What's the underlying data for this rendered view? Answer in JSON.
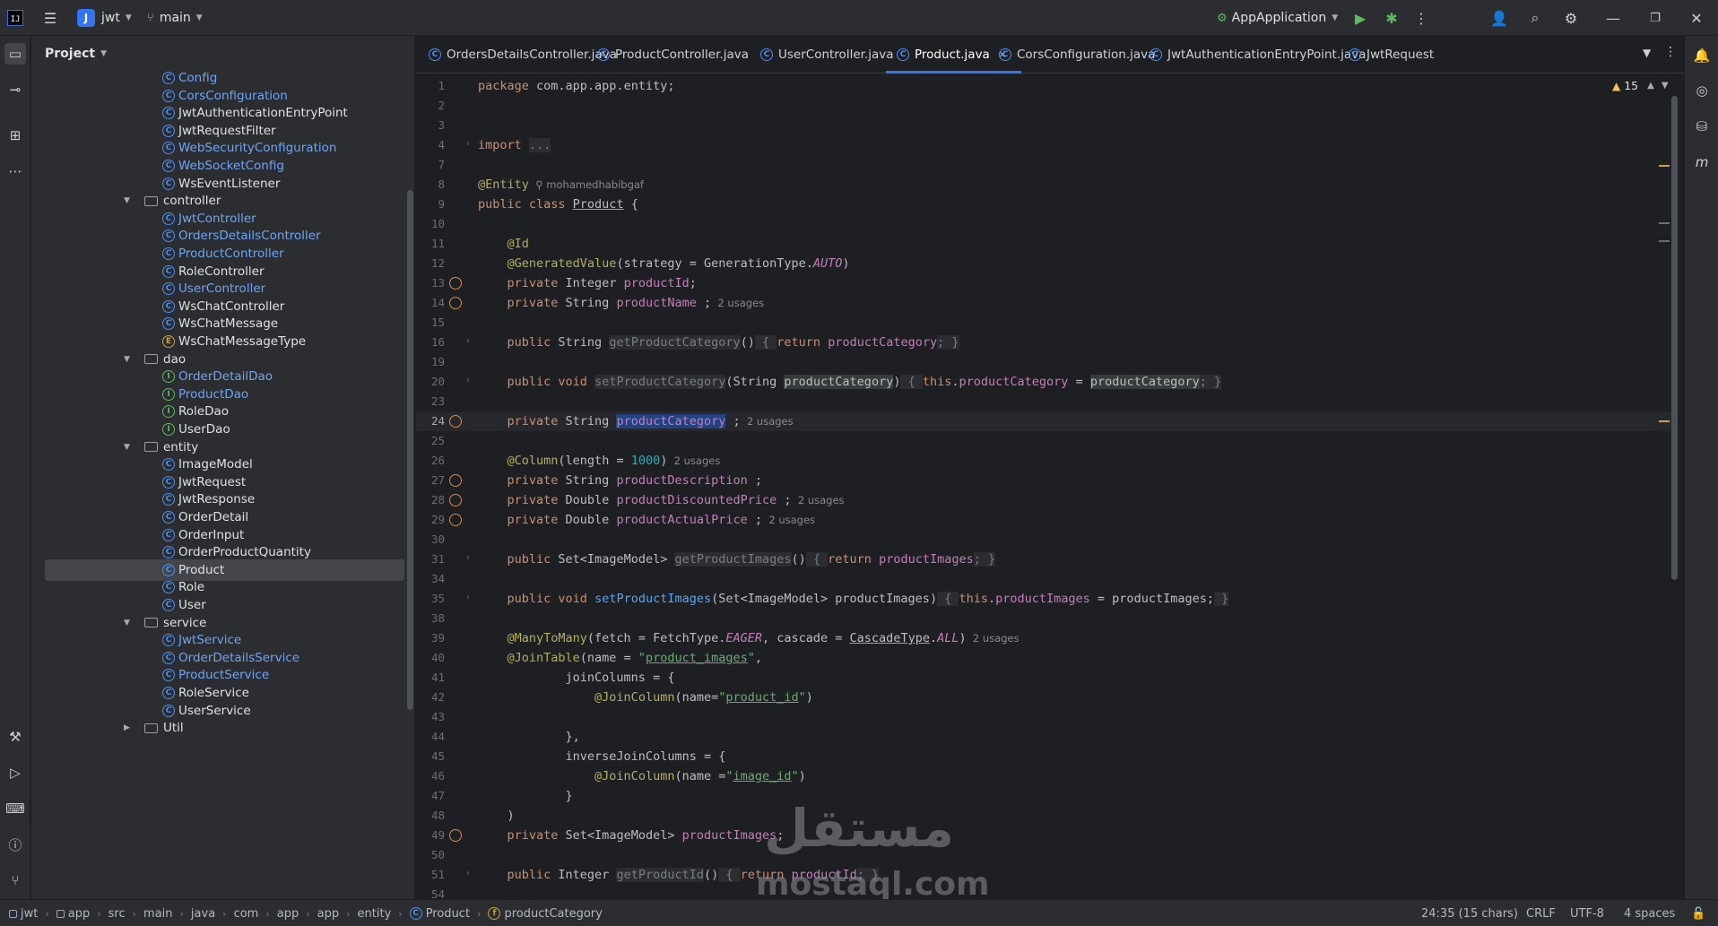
{
  "titlebar": {
    "project_letter": "J",
    "project_name": "jwt",
    "branch": "main",
    "run_config": "AppApplication",
    "icons": [
      "hamburger-menu-icon",
      "run-icon",
      "debug-icon",
      "more-icon",
      "add-user-icon",
      "search-icon",
      "settings-icon",
      "minimize-icon",
      "restore-icon",
      "close-icon"
    ]
  },
  "project_panel": {
    "title": "Project",
    "items": [
      {
        "label": "Config",
        "kind": "class",
        "style": "blue",
        "depth": 2
      },
      {
        "label": "CorsConfiguration",
        "kind": "class",
        "style": "blue",
        "depth": 2
      },
      {
        "label": "JwtAuthenticationEntryPoint",
        "kind": "class",
        "style": "normal",
        "depth": 2
      },
      {
        "label": "JwtRequestFilter",
        "kind": "class",
        "style": "normal",
        "depth": 2
      },
      {
        "label": "WebSecurityConfiguration",
        "kind": "class",
        "style": "blue",
        "depth": 2
      },
      {
        "label": "WebSocketConfig",
        "kind": "class",
        "style": "blue",
        "depth": 2
      },
      {
        "label": "WsEventListener",
        "kind": "class",
        "style": "normal",
        "depth": 2
      },
      {
        "label": "controller",
        "kind": "folder",
        "style": "normal",
        "depth": 1
      },
      {
        "label": "JwtController",
        "kind": "class",
        "style": "blue",
        "depth": 2
      },
      {
        "label": "OrdersDetailsController",
        "kind": "class",
        "style": "blue",
        "depth": 2
      },
      {
        "label": "ProductController",
        "kind": "class",
        "style": "blue",
        "depth": 2
      },
      {
        "label": "RoleController",
        "kind": "class",
        "style": "normal",
        "depth": 2
      },
      {
        "label": "UserController",
        "kind": "class",
        "style": "blue",
        "depth": 2
      },
      {
        "label": "WsChatController",
        "kind": "class",
        "style": "normal",
        "depth": 2
      },
      {
        "label": "WsChatMessage",
        "kind": "class",
        "style": "normal",
        "depth": 2
      },
      {
        "label": "WsChatMessageType",
        "kind": "enum",
        "style": "normal",
        "depth": 2
      },
      {
        "label": "dao",
        "kind": "folder",
        "style": "normal",
        "depth": 1
      },
      {
        "label": "OrderDetailDao",
        "kind": "interface",
        "style": "blue",
        "depth": 2
      },
      {
        "label": "ProductDao",
        "kind": "interface",
        "style": "blue",
        "depth": 2
      },
      {
        "label": "RoleDao",
        "kind": "interface",
        "style": "normal",
        "depth": 2
      },
      {
        "label": "UserDao",
        "kind": "interface",
        "style": "normal",
        "depth": 2
      },
      {
        "label": "entity",
        "kind": "folder",
        "style": "normal",
        "depth": 1
      },
      {
        "label": "ImageModel",
        "kind": "class",
        "style": "normal",
        "depth": 2
      },
      {
        "label": "JwtRequest",
        "kind": "class",
        "style": "normal",
        "depth": 2
      },
      {
        "label": "JwtResponse",
        "kind": "class",
        "style": "normal",
        "depth": 2
      },
      {
        "label": "OrderDetail",
        "kind": "class",
        "style": "normal",
        "depth": 2
      },
      {
        "label": "OrderInput",
        "kind": "class",
        "style": "normal",
        "depth": 2
      },
      {
        "label": "OrderProductQuantity",
        "kind": "class",
        "style": "normal",
        "depth": 2
      },
      {
        "label": "Product",
        "kind": "class",
        "style": "normal",
        "depth": 2,
        "selected": true
      },
      {
        "label": "Role",
        "kind": "class",
        "style": "normal",
        "depth": 2
      },
      {
        "label": "User",
        "kind": "class",
        "style": "normal",
        "depth": 2
      },
      {
        "label": "service",
        "kind": "folder",
        "style": "normal",
        "depth": 1
      },
      {
        "label": "JwtService",
        "kind": "class",
        "style": "blue",
        "depth": 2
      },
      {
        "label": "OrderDetailsService",
        "kind": "class",
        "style": "blue",
        "depth": 2
      },
      {
        "label": "ProductService",
        "kind": "class",
        "style": "blue",
        "depth": 2
      },
      {
        "label": "RoleService",
        "kind": "class",
        "style": "normal",
        "depth": 2
      },
      {
        "label": "UserService",
        "kind": "class",
        "style": "normal",
        "depth": 2
      },
      {
        "label": "Util",
        "kind": "folder",
        "style": "normal",
        "depth": 1,
        "collapsed": true
      }
    ]
  },
  "tabs": [
    {
      "label": "OrdersDetailsController.java",
      "active": false
    },
    {
      "label": "ProductController.java",
      "active": false
    },
    {
      "label": "UserController.java",
      "active": false
    },
    {
      "label": "Product.java",
      "active": true
    },
    {
      "label": "CorsConfiguration.java",
      "active": false
    },
    {
      "label": "JwtAuthenticationEntryPoint.java",
      "active": false
    },
    {
      "label": "JwtRequest",
      "active": false
    }
  ],
  "editor": {
    "warnings_count": "15",
    "current_line": "24",
    "lines": [
      {
        "n": "1",
        "tokens": [
          [
            "kw",
            "package "
          ],
          [
            "",
            "com.app.app.entity;"
          ]
        ]
      },
      {
        "n": "2",
        "tokens": []
      },
      {
        "n": "3",
        "tokens": []
      },
      {
        "n": "4",
        "fold": true,
        "tokens": [
          [
            "kw",
            "import "
          ],
          [
            "dim",
            "..."
          ]
        ]
      },
      {
        "n": "7",
        "tokens": []
      },
      {
        "n": "8",
        "tokens": [
          [
            "ann",
            "@Entity"
          ],
          [
            "hint",
            "  ⚲ mohamedhabibgaf"
          ]
        ]
      },
      {
        "n": "9",
        "tokens": [
          [
            "kw",
            "public class "
          ],
          [
            "cls-u",
            "Product"
          ],
          [
            "",
            " {"
          ]
        ]
      },
      {
        "n": "10",
        "tokens": []
      },
      {
        "n": "11",
        "tokens": [
          [
            "",
            "    "
          ],
          [
            "ann",
            "@Id"
          ]
        ]
      },
      {
        "n": "12",
        "tokens": [
          [
            "",
            "    "
          ],
          [
            "ann",
            "@GeneratedValue"
          ],
          [
            "",
            "(strategy = GenerationType."
          ],
          [
            "ital",
            "AUTO"
          ],
          [
            "",
            ")"
          ]
        ]
      },
      {
        "n": "13",
        "icon": true,
        "tokens": [
          [
            "",
            "    "
          ],
          [
            "kw",
            "private "
          ],
          [
            "",
            "Integer "
          ],
          [
            "fld",
            "productId"
          ],
          [
            "",
            ";"
          ]
        ]
      },
      {
        "n": "14",
        "icon": true,
        "tokens": [
          [
            "",
            "    "
          ],
          [
            "kw",
            "private "
          ],
          [
            "",
            "String "
          ],
          [
            "fld",
            "productName"
          ],
          [
            "",
            " ;"
          ],
          [
            "hint",
            "  2 usages"
          ]
        ]
      },
      {
        "n": "15",
        "tokens": []
      },
      {
        "n": "16",
        "fold": true,
        "tokens": [
          [
            "",
            "    "
          ],
          [
            "kw",
            "public "
          ],
          [
            "",
            "String "
          ],
          [
            "dim",
            "get"
          ],
          [
            "dim",
            "ProductCategory"
          ],
          [
            "",
            "()"
          ],
          [
            "dim",
            " { "
          ],
          [
            "kw",
            "return "
          ],
          [
            "fld",
            "productCategory"
          ],
          [
            "dim",
            "; }"
          ]
        ]
      },
      {
        "n": "19",
        "tokens": []
      },
      {
        "n": "20",
        "fold": true,
        "tokens": [
          [
            "",
            "    "
          ],
          [
            "kw",
            "public void "
          ],
          [
            "dim",
            "set"
          ],
          [
            "dim",
            "ProductCategory"
          ],
          [
            "",
            "(String "
          ],
          [
            "hl",
            "productCategory"
          ],
          [
            "",
            ")"
          ],
          [
            "dim",
            " { "
          ],
          [
            "kw",
            "this"
          ],
          [
            "",
            "."
          ],
          [
            "fld",
            "productCategory"
          ],
          [
            "",
            " = "
          ],
          [
            "hl",
            "productCategory"
          ],
          [
            "dim",
            "; }"
          ]
        ]
      },
      {
        "n": "23",
        "tokens": []
      },
      {
        "n": "24",
        "icon": true,
        "current": true,
        "tokens": [
          [
            "",
            "    "
          ],
          [
            "kw",
            "private "
          ],
          [
            "",
            "String "
          ],
          [
            "selword",
            "productCategory"
          ],
          [
            "",
            " ;"
          ],
          [
            "hint",
            "  2 usages"
          ]
        ]
      },
      {
        "n": "25",
        "tokens": []
      },
      {
        "n": "26",
        "tokens": [
          [
            "",
            "    "
          ],
          [
            "ann",
            "@Column"
          ],
          [
            "",
            "(length = "
          ],
          [
            "num",
            "1000"
          ],
          [
            "",
            ")"
          ],
          [
            "hint",
            "  2 usages"
          ]
        ]
      },
      {
        "n": "27",
        "icon": true,
        "tokens": [
          [
            "",
            "    "
          ],
          [
            "kw",
            "private "
          ],
          [
            "",
            "String "
          ],
          [
            "fld",
            "productDescription"
          ],
          [
            "",
            " ;"
          ]
        ]
      },
      {
        "n": "28",
        "icon": true,
        "tokens": [
          [
            "",
            "    "
          ],
          [
            "kw",
            "private "
          ],
          [
            "",
            "Double "
          ],
          [
            "fld",
            "productDiscountedPrice"
          ],
          [
            "",
            " ;"
          ],
          [
            "hint",
            "  2 usages"
          ]
        ]
      },
      {
        "n": "29",
        "icon": true,
        "tokens": [
          [
            "",
            "    "
          ],
          [
            "kw",
            "private "
          ],
          [
            "",
            "Double "
          ],
          [
            "fld",
            "productActualPrice"
          ],
          [
            "",
            " ;"
          ],
          [
            "hint",
            "  2 usages"
          ]
        ]
      },
      {
        "n": "30",
        "tokens": []
      },
      {
        "n": "31",
        "fold": true,
        "tokens": [
          [
            "",
            "    "
          ],
          [
            "kw",
            "public "
          ],
          [
            "",
            "Set<ImageModel> "
          ],
          [
            "dim",
            "getProductImages"
          ],
          [
            "",
            "()"
          ],
          [
            "dim",
            " { "
          ],
          [
            "kw",
            "return "
          ],
          [
            "fld",
            "productImages"
          ],
          [
            "dim",
            "; }"
          ]
        ]
      },
      {
        "n": "34",
        "tokens": []
      },
      {
        "n": "35",
        "fold": true,
        "tokens": [
          [
            "",
            "    "
          ],
          [
            "kw",
            "public void "
          ],
          [
            "fn",
            "setProductImages"
          ],
          [
            "",
            "(Set<ImageModel> productImages)"
          ],
          [
            "dim",
            " { "
          ],
          [
            "kw",
            "this"
          ],
          [
            "",
            "."
          ],
          [
            "fld",
            "productImages"
          ],
          [
            "",
            " = productImages;"
          ],
          [
            "dim",
            " }"
          ]
        ]
      },
      {
        "n": "38",
        "tokens": []
      },
      {
        "n": "39",
        "tokens": [
          [
            "",
            "    "
          ],
          [
            "ann",
            "@ManyToMany"
          ],
          [
            "",
            "(fetch = FetchType."
          ],
          [
            "ital",
            "EAGER"
          ],
          [
            "",
            ", cascade = "
          ],
          [
            "cls-u",
            "CascadeType"
          ],
          [
            "",
            "."
          ],
          [
            "ital",
            "ALL"
          ],
          [
            "",
            ")"
          ],
          [
            "hint",
            "  2 usages"
          ]
        ]
      },
      {
        "n": "40",
        "tokens": [
          [
            "",
            "    "
          ],
          [
            "ann",
            "@JoinTable"
          ],
          [
            "",
            "(name = "
          ],
          [
            "str",
            "\""
          ],
          [
            "str-u",
            "product_images"
          ],
          [
            "str",
            "\""
          ],
          [
            "",
            ","
          ]
        ]
      },
      {
        "n": "41",
        "tokens": [
          [
            "",
            "            joinColumns = {"
          ]
        ]
      },
      {
        "n": "42",
        "tokens": [
          [
            "",
            "                "
          ],
          [
            "ann",
            "@JoinColumn"
          ],
          [
            "",
            "(name="
          ],
          [
            "str",
            "\""
          ],
          [
            "str-u",
            "product_id"
          ],
          [
            "str",
            "\""
          ],
          [
            "",
            ")"
          ]
        ]
      },
      {
        "n": "43",
        "tokens": []
      },
      {
        "n": "44",
        "tokens": [
          [
            "",
            "            },"
          ]
        ]
      },
      {
        "n": "45",
        "tokens": [
          [
            "",
            "            inverseJoinColumns = {"
          ]
        ]
      },
      {
        "n": "46",
        "tokens": [
          [
            "",
            "                "
          ],
          [
            "ann",
            "@JoinColumn"
          ],
          [
            "",
            "(name ="
          ],
          [
            "str",
            "\""
          ],
          [
            "str-u",
            "image_id"
          ],
          [
            "str",
            "\""
          ],
          [
            "",
            ")"
          ]
        ]
      },
      {
        "n": "47",
        "tokens": [
          [
            "",
            "            }"
          ]
        ]
      },
      {
        "n": "48",
        "tokens": [
          [
            "",
            "    )"
          ]
        ]
      },
      {
        "n": "49",
        "icon": true,
        "tokens": [
          [
            "",
            "    "
          ],
          [
            "kw",
            "private "
          ],
          [
            "",
            "Set<ImageModel> "
          ],
          [
            "fld",
            "productImages"
          ],
          [
            "",
            ";"
          ]
        ]
      },
      {
        "n": "50",
        "tokens": []
      },
      {
        "n": "51",
        "fold": true,
        "tokens": [
          [
            "",
            "    "
          ],
          [
            "kw",
            "public "
          ],
          [
            "",
            "Integer "
          ],
          [
            "dim",
            "getProductId"
          ],
          [
            "",
            "()"
          ],
          [
            "dim",
            " { "
          ],
          [
            "kw",
            "return "
          ],
          [
            "fld",
            "productId"
          ],
          [
            "dim",
            "; }"
          ]
        ]
      },
      {
        "n": "54",
        "tokens": []
      }
    ]
  },
  "watermark": {
    "arabic": "مستقل",
    "latin": "mostaql.com"
  },
  "statusbar": {
    "breadcrumbs": [
      "jwt",
      "app",
      "src",
      "main",
      "java",
      "com",
      "app",
      "app",
      "entity",
      "Product",
      "productCategory"
    ],
    "position": "24:35 (15 chars)",
    "line_sep": "CRLF",
    "encoding": "UTF-8",
    "indent": "4 spaces"
  }
}
